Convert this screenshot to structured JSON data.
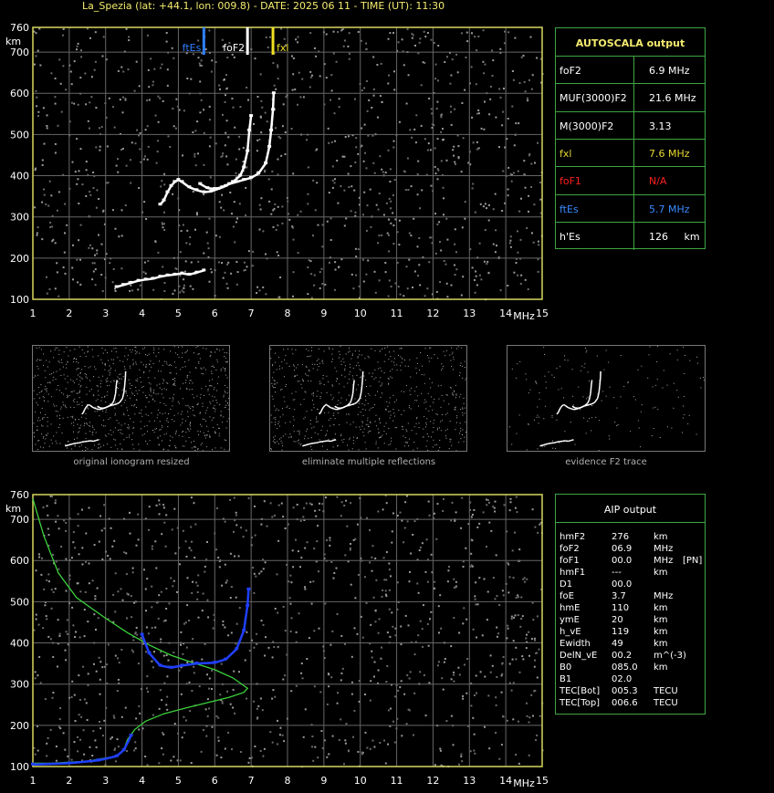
{
  "header": "La_Spezia (lat: +44.1, lon: 009.8) - DATE: 2025 06 11 - TIME (UT): 11:30",
  "chart_data": [
    {
      "type": "scatter",
      "title": "",
      "xlabel": "MHz",
      "ylabel": "km",
      "xlim": [
        1,
        15
      ],
      "ylim": [
        100,
        760
      ],
      "x_ticks": [
        1,
        2,
        3,
        4,
        5,
        6,
        7,
        8,
        9,
        10,
        11,
        12,
        13,
        14,
        15
      ],
      "y_ticks": [
        100,
        200,
        300,
        400,
        500,
        600,
        700,
        760
      ],
      "grid": true,
      "markers": [
        {
          "label": "ftEs",
          "x": 5.7,
          "color": "#2f7fff"
        },
        {
          "label": "foF2",
          "x": 6.9,
          "color": "#ffffff"
        },
        {
          "label": "fxl",
          "x": 7.6,
          "color": "#f0e020"
        }
      ],
      "series": [
        {
          "color": "#ffffff",
          "points": [
            [
              4.5,
              330
            ],
            [
              4.6,
              340
            ],
            [
              4.7,
              360
            ],
            [
              4.8,
              375
            ],
            [
              4.9,
              385
            ],
            [
              5.0,
              390
            ],
            [
              5.1,
              385
            ],
            [
              5.3,
              372
            ],
            [
              5.5,
              365
            ],
            [
              5.7,
              360
            ],
            [
              5.9,
              362
            ],
            [
              6.1,
              368
            ],
            [
              6.3,
              375
            ],
            [
              6.5,
              385
            ],
            [
              6.7,
              400
            ],
            [
              6.8,
              420
            ],
            [
              6.9,
              460
            ],
            [
              6.95,
              510
            ],
            [
              7.0,
              545
            ]
          ]
        },
        {
          "color": "#ffffff",
          "points": [
            [
              5.6,
              380
            ],
            [
              5.8,
              370
            ],
            [
              6.0,
              368
            ],
            [
              6.2,
              372
            ],
            [
              6.4,
              380
            ],
            [
              6.6,
              385
            ],
            [
              6.8,
              390
            ],
            [
              7.0,
              395
            ],
            [
              7.2,
              405
            ],
            [
              7.4,
              430
            ],
            [
              7.5,
              470
            ],
            [
              7.55,
              510
            ],
            [
              7.6,
              560
            ],
            [
              7.62,
              600
            ]
          ]
        },
        {
          "color": "#ffffff",
          "points": [
            [
              3.3,
              130
            ],
            [
              3.5,
              135
            ],
            [
              3.7,
              140
            ],
            [
              3.9,
              145
            ],
            [
              4.1,
              148
            ],
            [
              4.3,
              150
            ],
            [
              4.5,
              155
            ],
            [
              4.7,
              158
            ],
            [
              4.9,
              160
            ],
            [
              5.1,
              163
            ],
            [
              5.3,
              160
            ],
            [
              5.5,
              165
            ],
            [
              5.7,
              170
            ]
          ]
        }
      ]
    },
    {
      "type": "line",
      "title": "",
      "xlabel": "MHz",
      "ylabel": "km",
      "xlim": [
        1,
        15
      ],
      "ylim": [
        100,
        760
      ],
      "x_ticks": [
        1,
        2,
        3,
        4,
        5,
        6,
        7,
        8,
        9,
        10,
        11,
        12,
        13,
        14,
        15
      ],
      "y_ticks": [
        100,
        200,
        300,
        400,
        500,
        600,
        700,
        760
      ],
      "grid": true,
      "series": [
        {
          "color": "#3cd23c",
          "points": [
            [
              1.0,
              750
            ],
            [
              1.3,
              660
            ],
            [
              1.7,
              570
            ],
            [
              2.2,
              510
            ],
            [
              3.0,
              460
            ],
            [
              3.6,
              425
            ],
            [
              4.2,
              395
            ],
            [
              4.8,
              370
            ],
            [
              5.4,
              352
            ],
            [
              6.0,
              335
            ],
            [
              6.5,
              315
            ],
            [
              6.9,
              290
            ],
            [
              6.8,
              280
            ],
            [
              6.4,
              268
            ],
            [
              5.8,
              255
            ],
            [
              5.2,
              242
            ],
            [
              4.6,
              228
            ],
            [
              4.1,
              210
            ],
            [
              3.8,
              190
            ],
            [
              3.6,
              165
            ],
            [
              3.5,
              140
            ],
            [
              3.3,
              125
            ],
            [
              2.5,
              113
            ],
            [
              1.5,
              108
            ],
            [
              1.0,
              108
            ]
          ]
        },
        {
          "color": "#2040ff",
          "points": [
            [
              1.0,
              105
            ],
            [
              2.0,
              108
            ],
            [
              2.8,
              115
            ],
            [
              3.3,
              125
            ],
            [
              3.5,
              140
            ],
            [
              3.7,
              175
            ]
          ]
        },
        {
          "color": "#2040ff",
          "points": [
            [
              4.0,
              420
            ],
            [
              4.2,
              375
            ],
            [
              4.5,
              345
            ],
            [
              4.8,
              340
            ],
            [
              5.1,
              345
            ],
            [
              5.5,
              350
            ],
            [
              6.0,
              352
            ],
            [
              6.3,
              360
            ],
            [
              6.6,
              385
            ],
            [
              6.8,
              430
            ],
            [
              6.9,
              490
            ],
            [
              6.93,
              530
            ]
          ]
        }
      ]
    }
  ],
  "autoscala": {
    "title": "AUTOSCALA output",
    "rows": [
      {
        "key": "foF2",
        "value": "6.9 MHz",
        "color": "#ffffff"
      },
      {
        "key": "MUF(3000)F2",
        "value": "21.6 MHz",
        "color": "#ffffff"
      },
      {
        "key": "M(3000)F2",
        "value": "3.13",
        "color": "#ffffff"
      },
      {
        "key": "fxl",
        "value": "7.6 MHz",
        "color": "#e8d832"
      },
      {
        "key": "foF1",
        "value": "N/A",
        "color": "#ff2020"
      },
      {
        "key": "ftEs",
        "value": "5.7 MHz",
        "color": "#3a8bff"
      },
      {
        "key": "h'Es",
        "value": "126     km",
        "color": "#ffffff"
      }
    ]
  },
  "thumbs": [
    {
      "caption": "original ionogram resized"
    },
    {
      "caption": "eliminate multiple reflections"
    },
    {
      "caption": "evidence F2 trace"
    }
  ],
  "aip": {
    "title": "AIP output",
    "rows": [
      {
        "k": "hmF2",
        "v": "276",
        "u": "km",
        "x": ""
      },
      {
        "k": "foF2",
        "v": "06.9",
        "u": "MHz",
        "x": ""
      },
      {
        "k": "foF1",
        "v": "00.0",
        "u": "MHz",
        "x": "[PN]"
      },
      {
        "k": "hmF1",
        "v": "---",
        "u": "km",
        "x": ""
      },
      {
        "k": "D1",
        "v": "00.0",
        "u": "",
        "x": ""
      },
      {
        "k": "foE",
        "v": "3.7",
        "u": "MHz",
        "x": ""
      },
      {
        "k": "hmE",
        "v": "110",
        "u": "km",
        "x": ""
      },
      {
        "k": "ymE",
        "v": "20",
        "u": "km",
        "x": ""
      },
      {
        "k": "h_vE",
        "v": "119",
        "u": "km",
        "x": ""
      },
      {
        "k": "Ewidth",
        "v": "49",
        "u": "km",
        "x": ""
      },
      {
        "k": "DelN_vE",
        "v": "00.2",
        "u": "m^(-3)",
        "x": ""
      },
      {
        "k": "B0",
        "v": "085.0",
        "u": "km",
        "x": ""
      },
      {
        "k": "B1",
        "v": "02.0",
        "u": "",
        "x": ""
      },
      {
        "k": "TEC[Bot]",
        "v": "005.3",
        "u": "TECU",
        "x": ""
      },
      {
        "k": "TEC[Top]",
        "v": "006.6",
        "u": "TECU",
        "x": ""
      }
    ]
  }
}
